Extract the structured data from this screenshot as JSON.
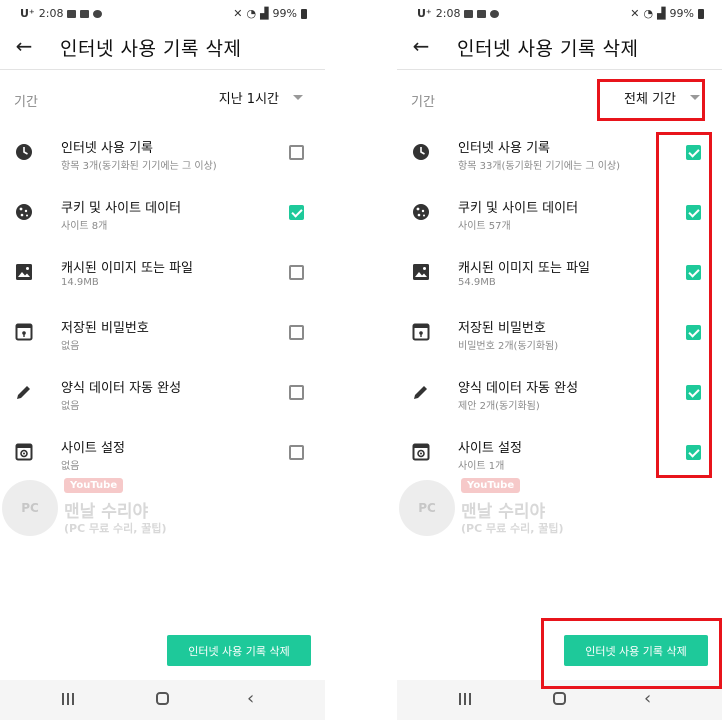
{
  "left_screen": {
    "status": {
      "carrier": "U⁺",
      "time": "2:08",
      "battery": "99%"
    },
    "title": "인터넷 사용 기록 삭제",
    "period_label": "기간",
    "period_value": "지난 1시간",
    "items": [
      {
        "title": "인터넷 사용 기록",
        "sub": "항목 3개(동기화된 기기에는 그 이상)",
        "checked": false
      },
      {
        "title": "쿠키 및 사이트 데이터",
        "sub": "사이트 8개",
        "checked": true
      },
      {
        "title": "캐시된 이미지 또는 파일",
        "sub": "14.9MB",
        "checked": false
      },
      {
        "title": "저장된 비밀번호",
        "sub": "없음",
        "checked": false
      },
      {
        "title": "양식 데이터 자동 완성",
        "sub": "없음",
        "checked": false
      },
      {
        "title": "사이트 설정",
        "sub": "없음",
        "checked": false
      }
    ],
    "delete_button": "인터넷 사용 기록 삭제"
  },
  "right_screen": {
    "status": {
      "carrier": "U⁺",
      "time": "2:08",
      "battery": "99%"
    },
    "title": "인터넷 사용 기록 삭제",
    "period_label": "기간",
    "period_value": "전체 기간",
    "items": [
      {
        "title": "인터넷 사용 기록",
        "sub": "항목 33개(동기화된 기기에는 그 이상)",
        "checked": true
      },
      {
        "title": "쿠키 및 사이트 데이터",
        "sub": "사이트 57개",
        "checked": true
      },
      {
        "title": "캐시된 이미지 또는 파일",
        "sub": "54.9MB",
        "checked": true
      },
      {
        "title": "저장된 비밀번호",
        "sub": "비밀번호 2개(동기화됨)",
        "checked": true
      },
      {
        "title": "양식 데이터 자동 완성",
        "sub": "제안 2개(동기화됨)",
        "checked": true
      },
      {
        "title": "사이트 설정",
        "sub": "사이트 1개",
        "checked": true
      }
    ],
    "delete_button": "인터넷 사용 기록 삭제"
  },
  "watermark": {
    "logo": "PC",
    "youtube": "YouTube",
    "name": "맨날 수리야",
    "sub": "(PC 무료 수리, 꿀팁)"
  },
  "colors": {
    "accent": "#1ec99a",
    "highlight": "#e8141b"
  },
  "icons": [
    "clock-icon",
    "cookie-icon",
    "image-icon",
    "password-icon",
    "pencil-icon",
    "site-settings-icon"
  ]
}
